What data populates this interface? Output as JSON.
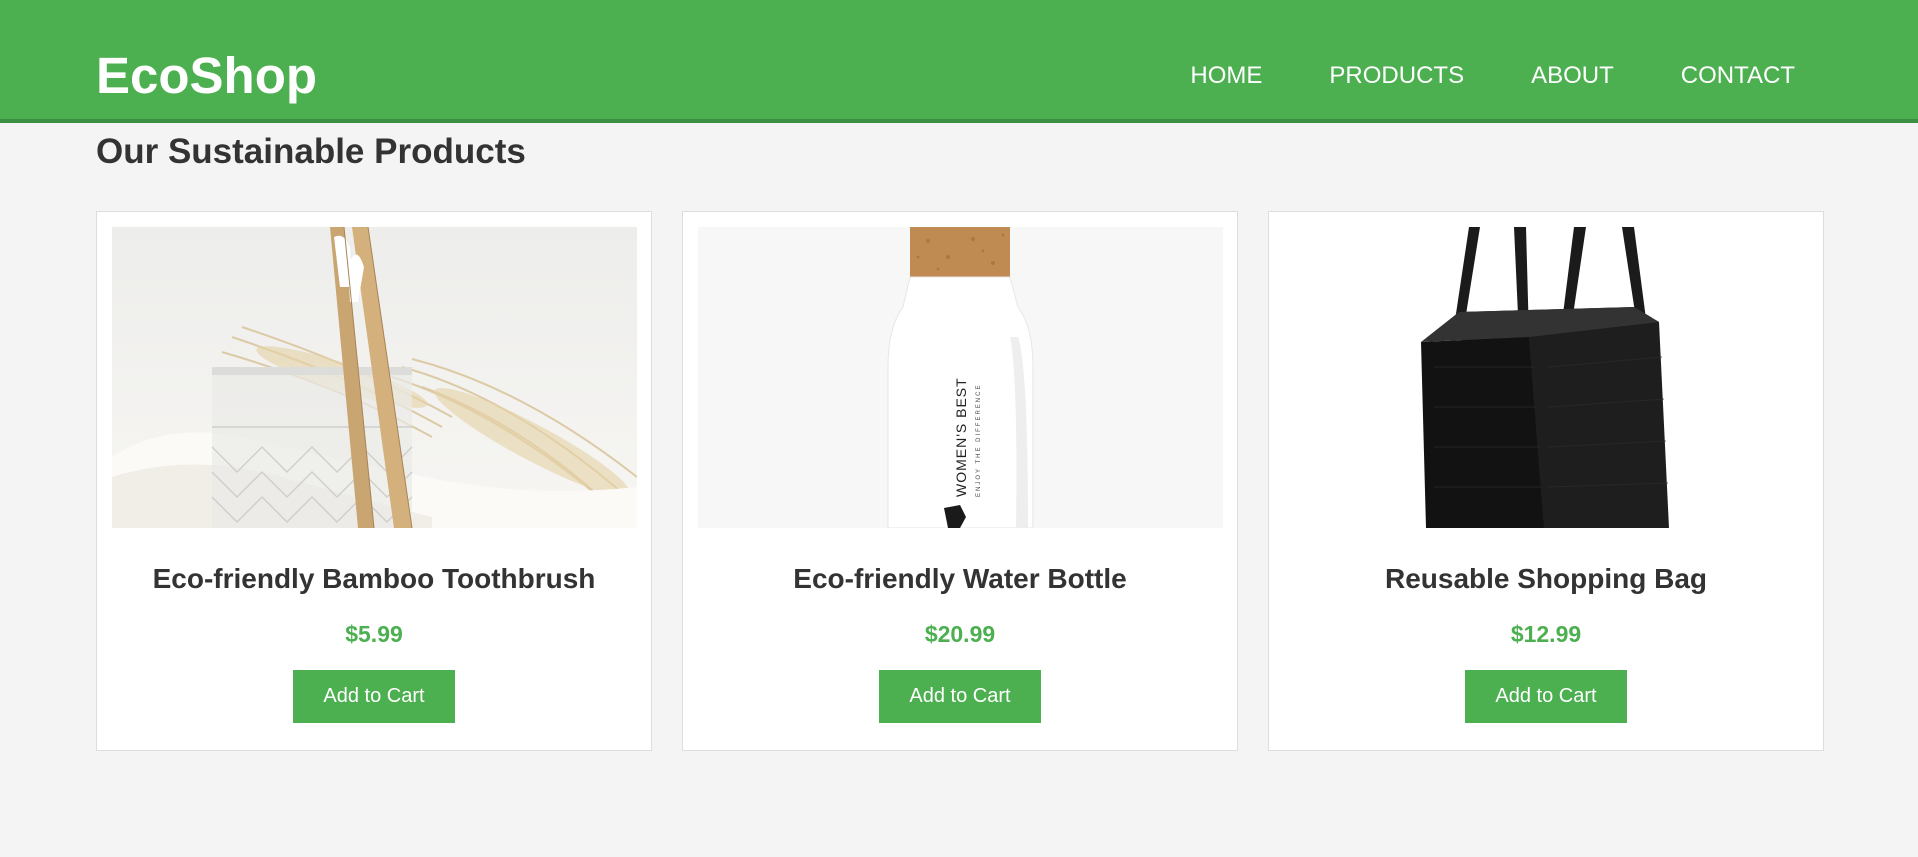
{
  "header": {
    "logo": "EcoShop",
    "nav": [
      "HOME",
      "PRODUCTS",
      "ABOUT",
      "CONTACT"
    ]
  },
  "main": {
    "title": "Our Sustainable Products",
    "products": [
      {
        "name": "Eco-friendly Bamboo Toothbrush",
        "price": "$5.99",
        "button": "Add to Cart",
        "image": "bamboo-toothbrush-photo"
      },
      {
        "name": "Eco-friendly Water Bottle",
        "price": "$20.99",
        "button": "Add to Cart",
        "image": "water-bottle-photo",
        "image_text": "WOMEN'S BEST",
        "image_subtext": "ENJOY THE DIFFERENCE"
      },
      {
        "name": "Reusable Shopping Bag",
        "price": "$12.99",
        "button": "Add to Cart",
        "image": "shopping-bag-photo"
      }
    ]
  },
  "colors": {
    "brand": "#4caf50",
    "background": "#f4f4f4",
    "text": "#333333"
  }
}
